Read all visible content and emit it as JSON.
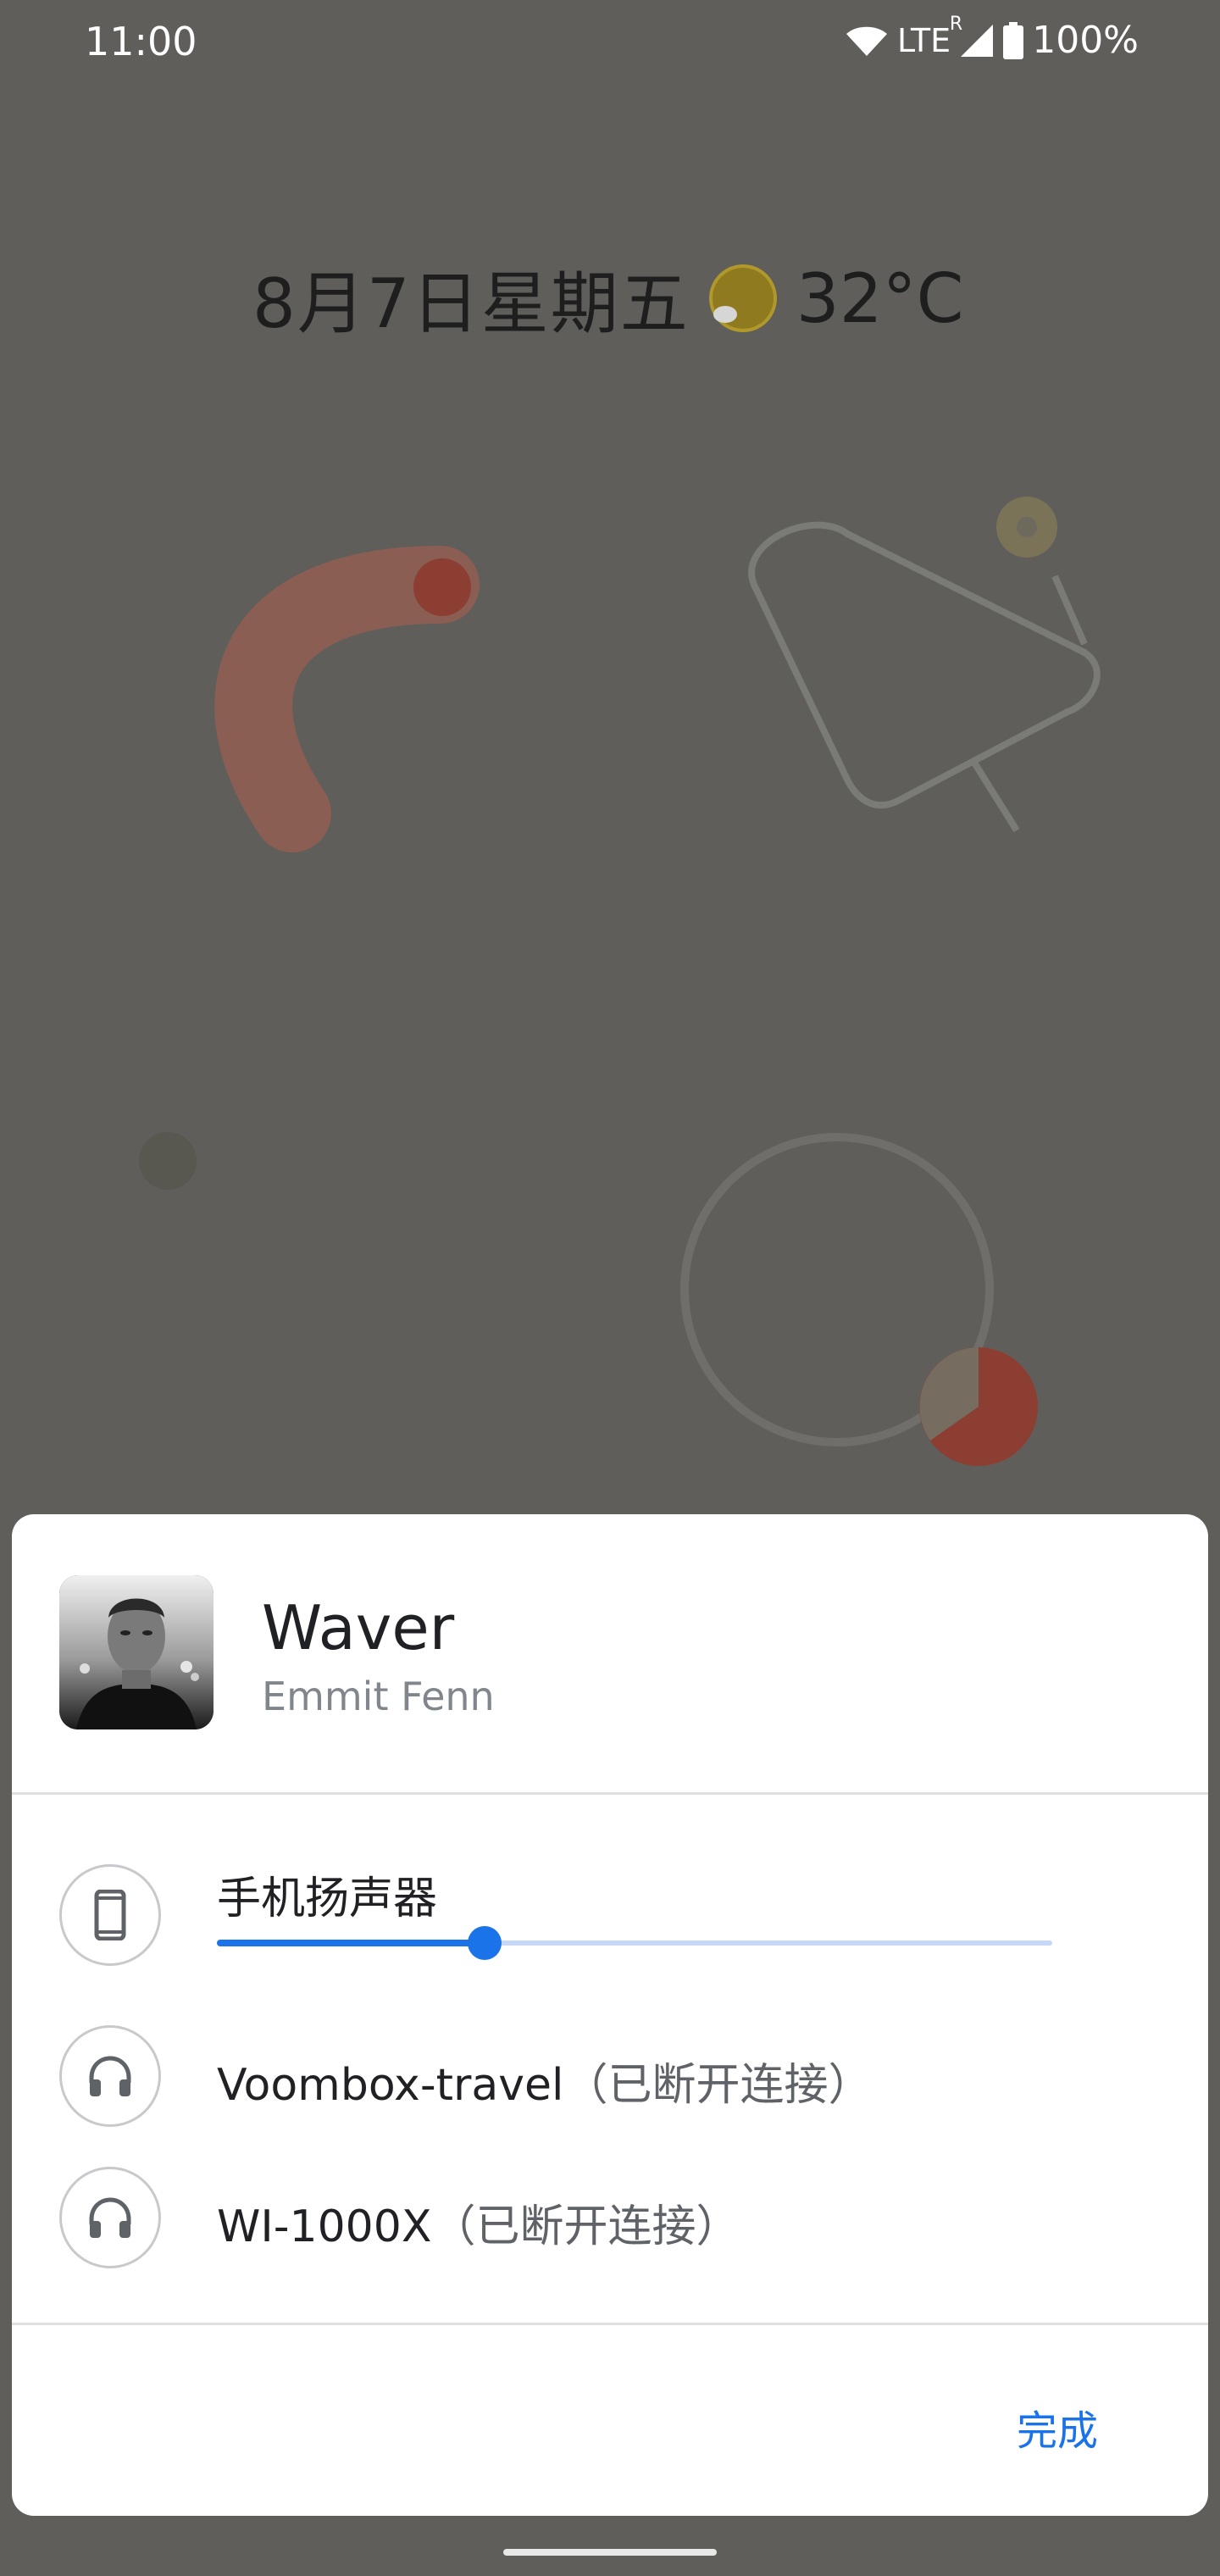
{
  "status_bar": {
    "time": "11:00",
    "network": "LTE",
    "roaming": "R",
    "battery": "100%",
    "icons": [
      "wifi-icon",
      "signal-icon",
      "battery-icon"
    ]
  },
  "lock_screen": {
    "date": "8月7日星期五",
    "weather_icon": "partly-sunny-icon",
    "temperature": "32°C"
  },
  "output_switcher": {
    "track": {
      "title": "Waver",
      "artist": "Emmit Fenn",
      "album_art": "album-art-portrait"
    },
    "devices": [
      {
        "name": "手机扬声器",
        "icon": "phone-icon",
        "status": "",
        "volume": 0.32
      },
      {
        "name": "Voombox-travel",
        "icon": "headphones-icon",
        "status": "（已断开连接）"
      },
      {
        "name": "WI-1000X",
        "icon": "headphones-icon",
        "status": "（已断开连接）"
      }
    ],
    "done_label": "完成"
  },
  "colors": {
    "accent": "#1a73e8",
    "wallpaper": "#5f5e5b",
    "sheet": "#ffffff"
  }
}
